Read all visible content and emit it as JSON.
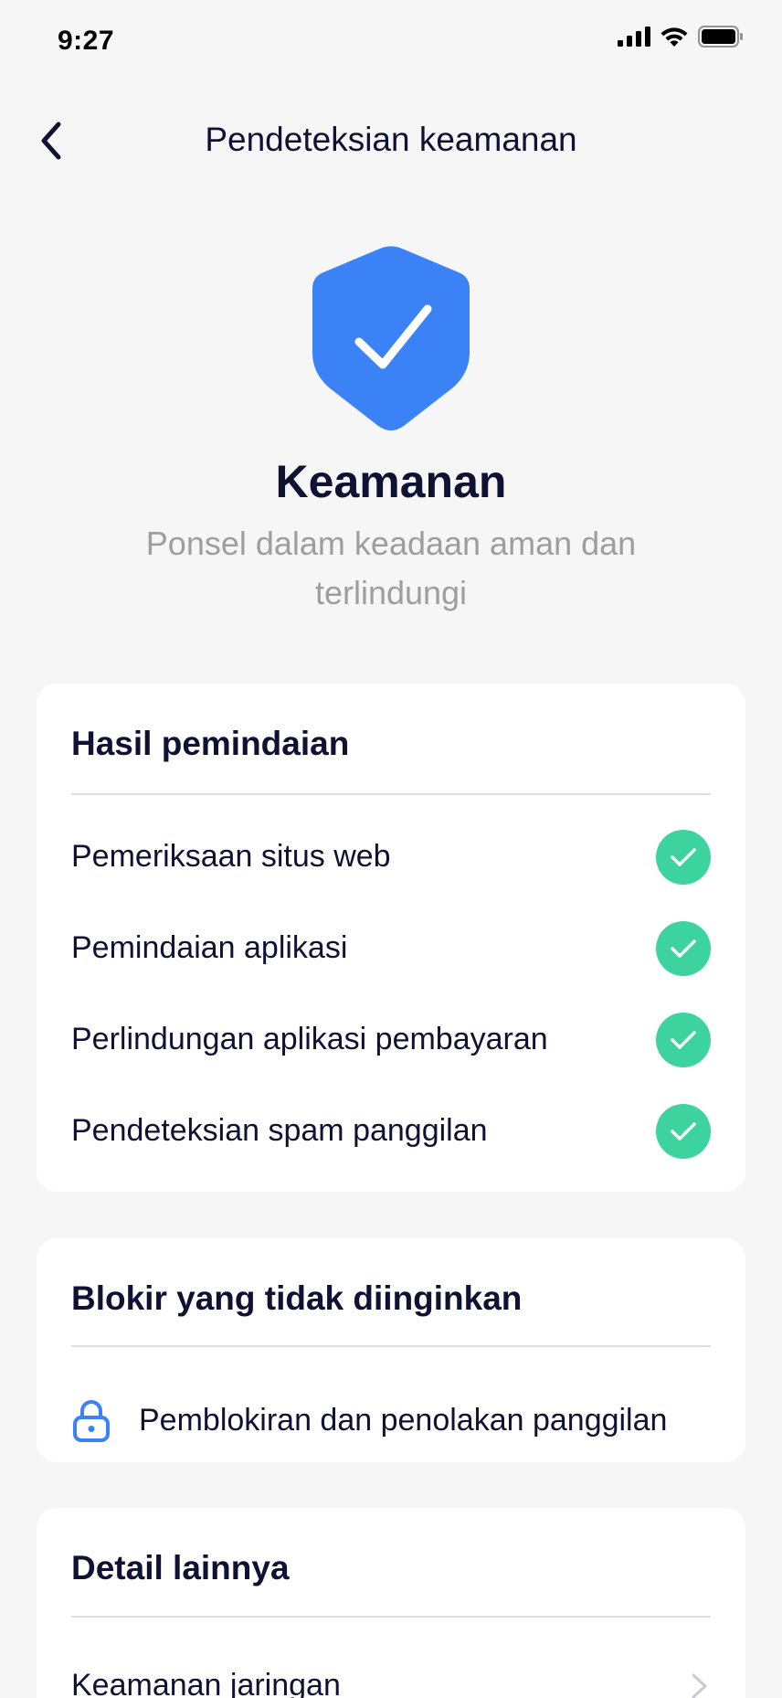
{
  "status_bar": {
    "time": "9:27",
    "icons": [
      "cellular-signal-icon",
      "wifi-icon",
      "battery-icon"
    ]
  },
  "header": {
    "title": "Pendeteksian keamanan",
    "back_icon": "chevron-left-icon"
  },
  "hero": {
    "icon": "shield-check-icon",
    "title": "Keamanan",
    "subtitle": "Ponsel dalam keadaan aman dan terlindungi"
  },
  "scan_results": {
    "title": "Hasil pemindaian",
    "items": [
      {
        "label": "Pemeriksaan situs web",
        "status_icon": "check-circle-icon"
      },
      {
        "label": "Pemindaian aplikasi",
        "status_icon": "check-circle-icon"
      },
      {
        "label": "Perlindungan aplikasi pembayaran",
        "status_icon": "check-circle-icon"
      },
      {
        "label": "Pendeteksian spam panggilan",
        "status_icon": "check-circle-icon"
      }
    ]
  },
  "block_unwanted": {
    "title": "Blokir yang tidak diinginkan",
    "item": {
      "label": "Pemblokiran dan penolakan panggilan",
      "icon": "lock-icon"
    }
  },
  "other_details": {
    "title": "Detail lainnya",
    "item": {
      "label": "Keamanan jaringan",
      "icon": "chevron-right-icon"
    }
  },
  "colors": {
    "background": "#F6F6F6",
    "card": "#FFFFFF",
    "primary_text": "#0F1233",
    "secondary_text": "#9E9E9E",
    "shield_blue": "#3B82F6",
    "success_green": "#3DD39E",
    "divider": "#DCDDE8"
  }
}
